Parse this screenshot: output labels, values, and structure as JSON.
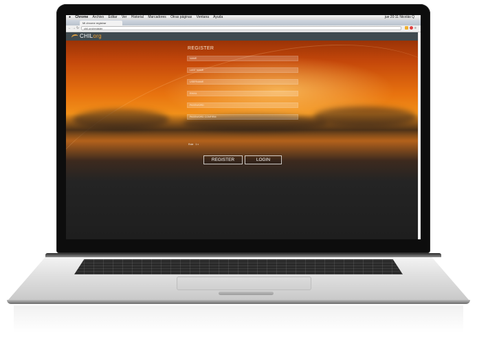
{
  "menubar": {
    "apple": "",
    "app": "Chrome",
    "items": [
      "Archivo",
      "Editar",
      "Ver",
      "Historial",
      "Marcadores",
      "Otras páginas",
      "Ventana",
      "Ayuda"
    ],
    "clock": "jue 20:11  Nicolás  Q"
  },
  "browser": {
    "tab_title": "Mi chrome registrar",
    "url": "chil.org/register"
  },
  "site": {
    "logo_main": "CHIL",
    "logo_accent": "org"
  },
  "form": {
    "title": "REGISTER",
    "fields": [
      {
        "placeholder": "NAME"
      },
      {
        "placeholder": "LAST NAME"
      },
      {
        "placeholder": "USERNAME"
      },
      {
        "placeholder": "EMAIL"
      },
      {
        "placeholder": "PASSWORD"
      },
      {
        "placeholder": "PASSWORD CONFIRM"
      }
    ],
    "pref_label": "Role",
    "pref_value": "1",
    "register_label": "REGISTER",
    "login_label": "LOGIN"
  },
  "colors": {
    "accent": "#f0a030",
    "header": "#3f4a4f",
    "sunset": "#e8730f"
  }
}
